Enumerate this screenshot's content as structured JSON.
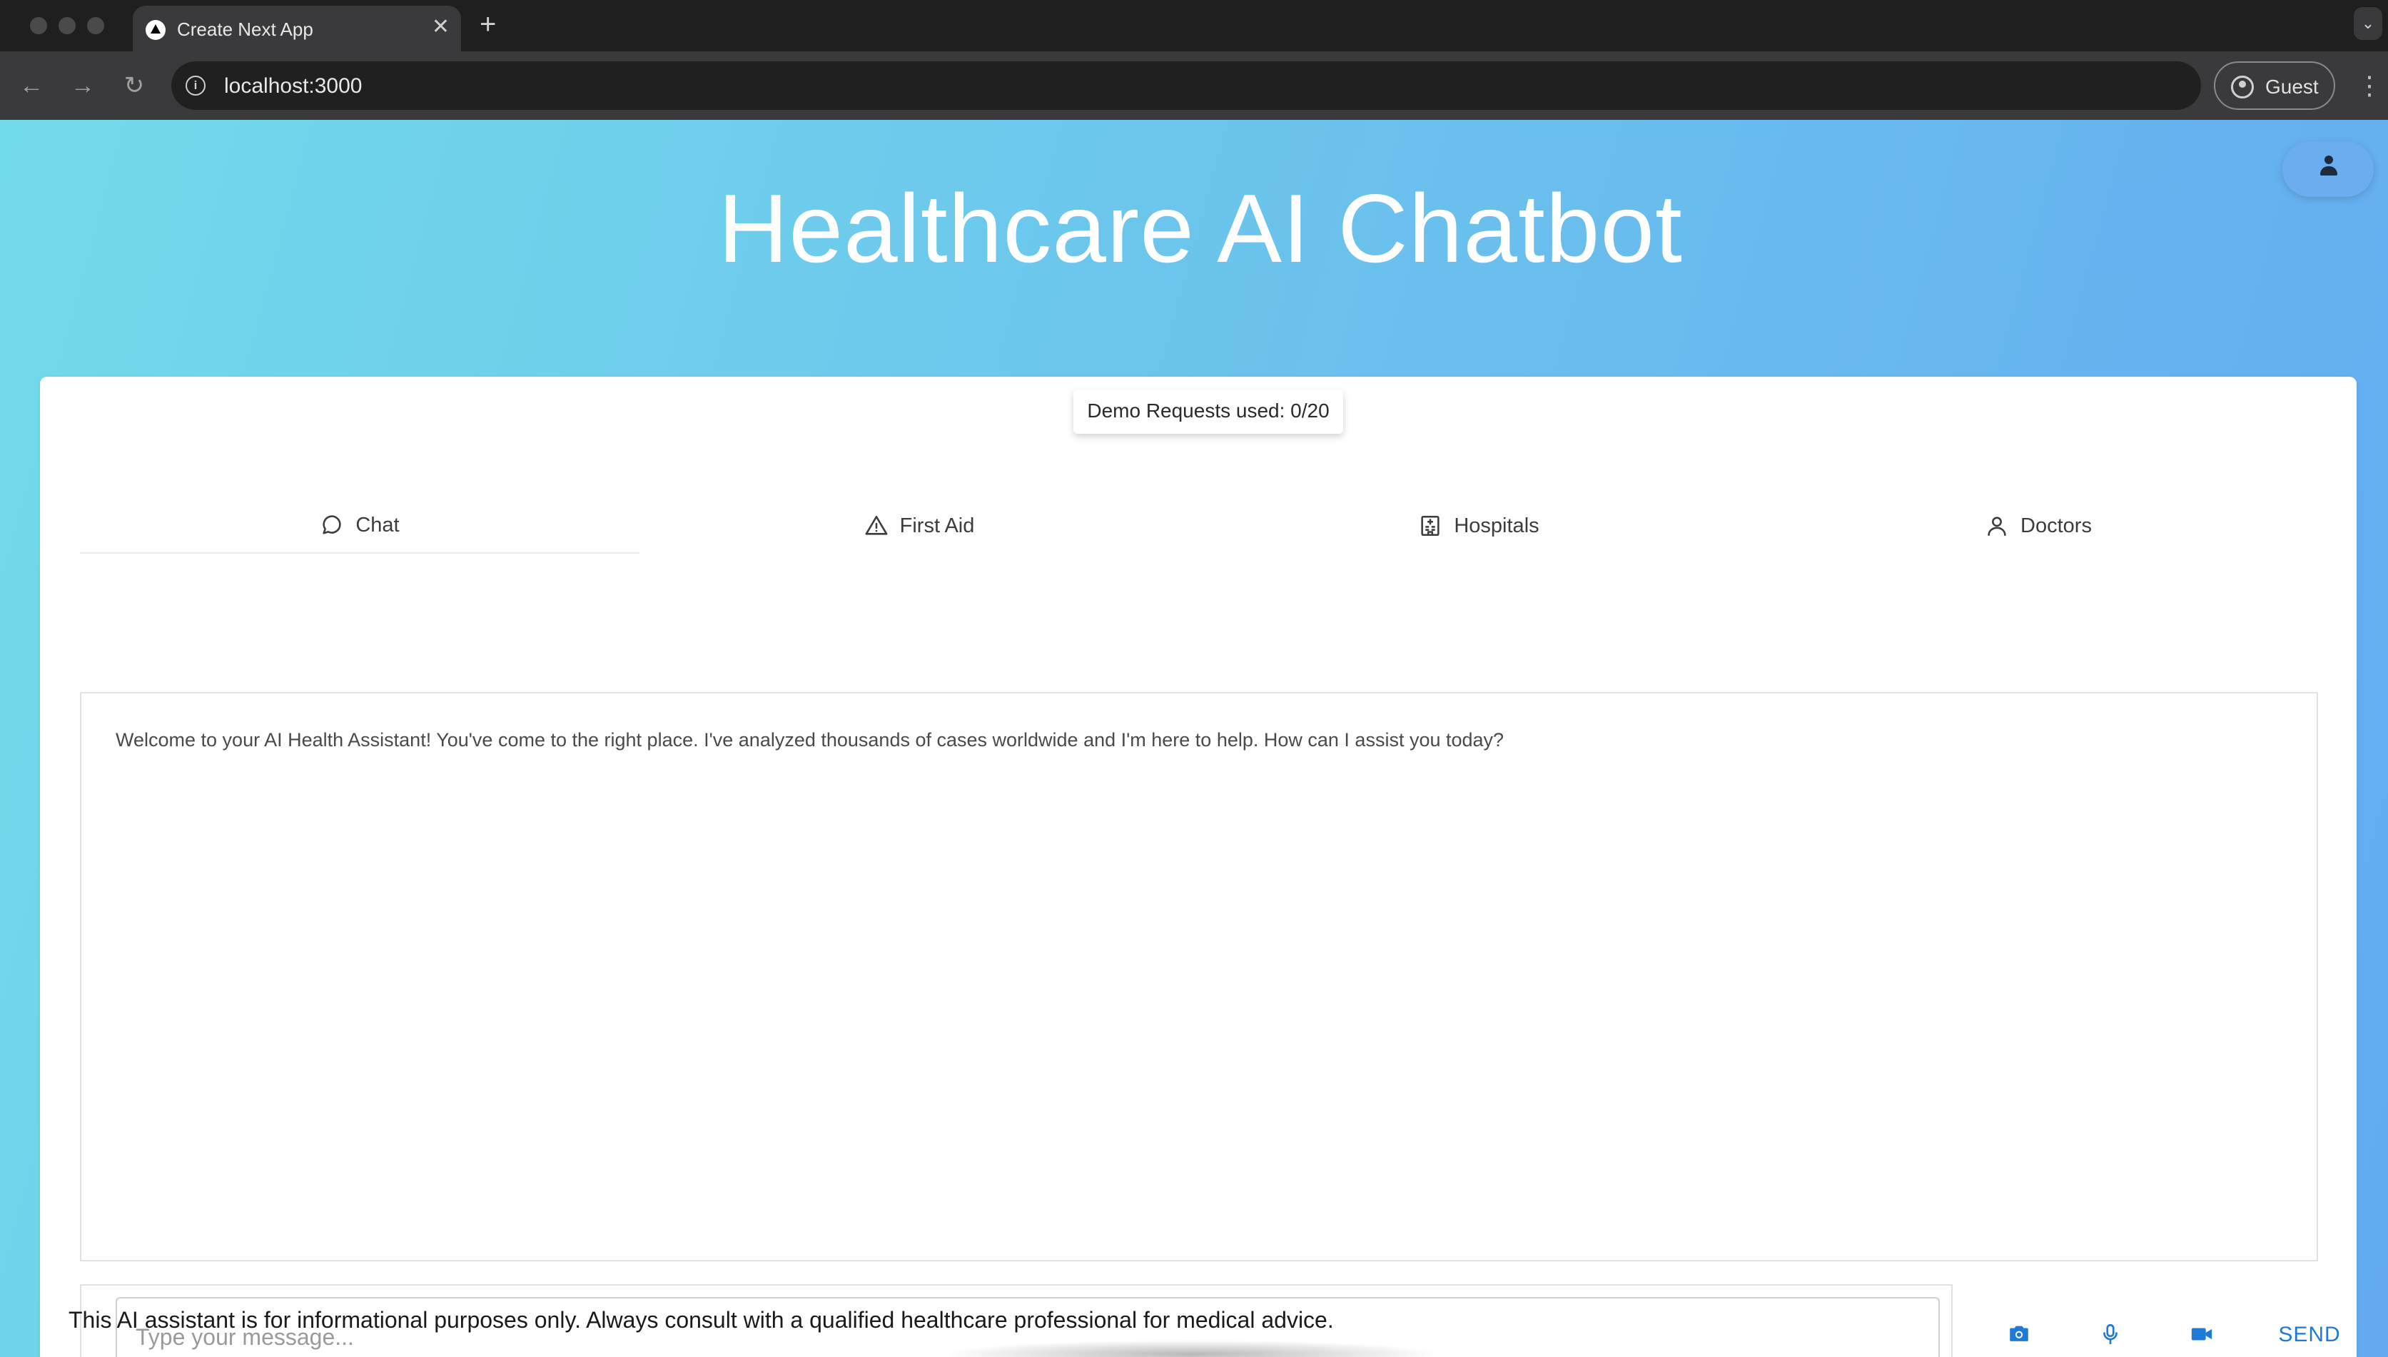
{
  "browser": {
    "tab_title": "Create Next App",
    "tab_close_glyph": "✕",
    "new_tab_glyph": "+",
    "url": "localhost:3000",
    "profile_label": "Guest"
  },
  "header": {
    "title": "Healthcare AI Chatbot"
  },
  "usage": {
    "demo_requests": "Demo Requests used: 0/20"
  },
  "tabs": [
    {
      "label": "Chat",
      "icon": "chat-bubble-icon",
      "active": true
    },
    {
      "label": "First Aid",
      "icon": "warning-triangle-icon",
      "active": false
    },
    {
      "label": "Hospitals",
      "icon": "hospital-building-icon",
      "active": false
    },
    {
      "label": "Doctors",
      "icon": "person-icon",
      "active": false
    }
  ],
  "chat": {
    "welcome_message": "Welcome to your AI Health Assistant! You've come to the right place. I've analyzed thousands of cases worldwide and I'm here to help. How can I assist you today?"
  },
  "composer": {
    "placeholder": "Type your message...",
    "value": "",
    "send_label": "SEND",
    "accent_color": "#1f7ad6"
  },
  "footer": {
    "disclaimer": "This AI assistant is for informational purposes only. Always consult with a qualified healthcare professional for medical advice."
  },
  "colors": {
    "gradient_start": "#72dbe9",
    "gradient_end": "#63aaf0"
  }
}
